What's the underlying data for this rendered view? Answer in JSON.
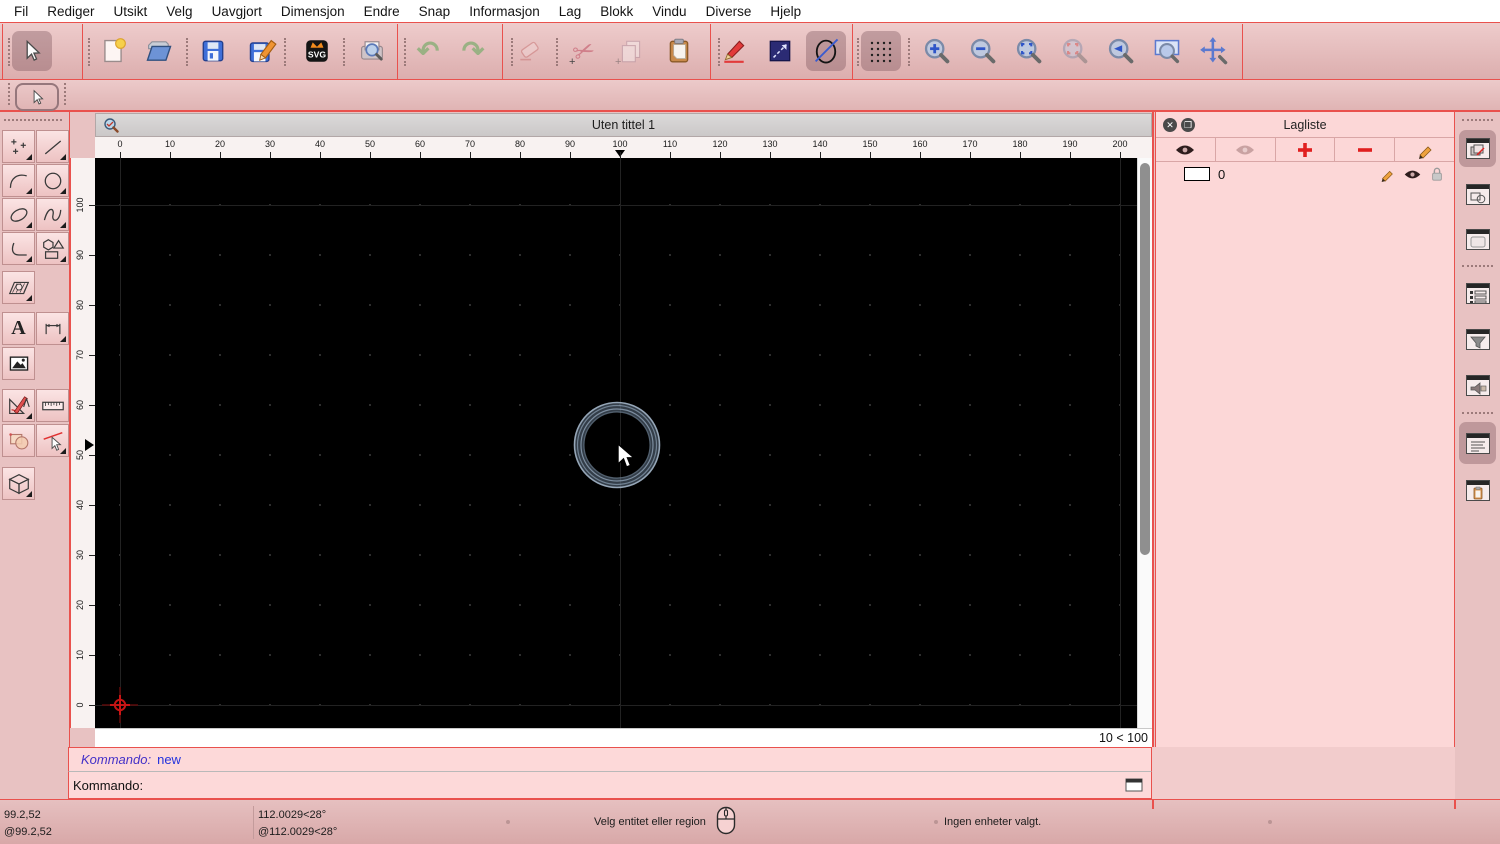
{
  "menu_bar": {
    "items": [
      "Fil",
      "Rediger",
      "Utsikt",
      "Velg",
      "Uavgjort",
      "Dimensjon",
      "Endre",
      "Snap",
      "Informasjon",
      "Lag",
      "Blokk",
      "Vindu",
      "Diverse",
      "Hjelp"
    ]
  },
  "toolbar": {
    "svg_icon_label": "SVG",
    "icons": [
      "selection-arrow",
      "new-document",
      "open-file",
      "save",
      "save-as",
      "svg-export",
      "print-preview",
      "undo",
      "redo",
      "eraser",
      "cut",
      "copy",
      "paste",
      "edit-attributes",
      "selection-box",
      "draw-ellipse",
      "grid-toggle",
      "zoom-in",
      "zoom-out",
      "zoom-auto",
      "zoom-selection",
      "zoom-previous",
      "zoom-window",
      "pan"
    ]
  },
  "tool_options": {
    "icons": [
      "selection-arrow"
    ]
  },
  "left_palette": {
    "text_tool_label": "A",
    "tools": [
      "point",
      "line",
      "arc",
      "circle",
      "ellipse",
      "spline",
      "polyline",
      "shapes",
      "hatch",
      "text",
      "dimension",
      "image",
      "cad-tools",
      "measure",
      "modify-shapes",
      "trim",
      "view-3d"
    ]
  },
  "canvas": {
    "window_title": "Uten tittel 1",
    "grid_info": "10 < 100",
    "h_ruler_ticks": [
      "0",
      "10",
      "20",
      "30",
      "40",
      "50",
      "60",
      "70",
      "80",
      "90",
      "100",
      "110",
      "120",
      "130",
      "140",
      "150",
      "160",
      "170",
      "180",
      "190",
      "200"
    ],
    "v_ruler_ticks": [
      "100",
      "90",
      "80",
      "70",
      "60",
      "50",
      "40",
      "30",
      "20",
      "10",
      "0"
    ],
    "entity": {
      "type": "circle",
      "color": "#7e93a6"
    }
  },
  "layer_panel": {
    "title": "Lagliste",
    "toolbar_icons": [
      "show-all-layers",
      "hide-all-layers",
      "add-layer",
      "remove-layer",
      "edit-layer"
    ],
    "layers": [
      {
        "name": "0"
      }
    ]
  },
  "right_dock": {
    "icons": [
      "layer-list-toggle",
      "block-list-toggle",
      "library-browser-toggle",
      "property-editor-toggle",
      "selection-filter-toggle",
      "render-panel-toggle",
      "command-line-toggle",
      "clipboard-panel-toggle"
    ]
  },
  "command_line": {
    "history_label": "Kommando:",
    "history_value": "new",
    "prompt_label": "Kommando:"
  },
  "status_bar": {
    "coord_abs": "99.2,52",
    "coord_rel": "@99.2,52",
    "polar_abs": "112.0029<28°",
    "polar_rel": "@112.0029<28°",
    "hint": "Velg entitet eller region",
    "selection_info": "Ingen enheter valgt."
  },
  "colors": {
    "accent_red": "#e9514d",
    "toolbar_pink": "#e8c2c2",
    "panel_pink": "#fcd7d7",
    "canvas_black": "#000000",
    "entity_blue": "#7e93a6"
  }
}
